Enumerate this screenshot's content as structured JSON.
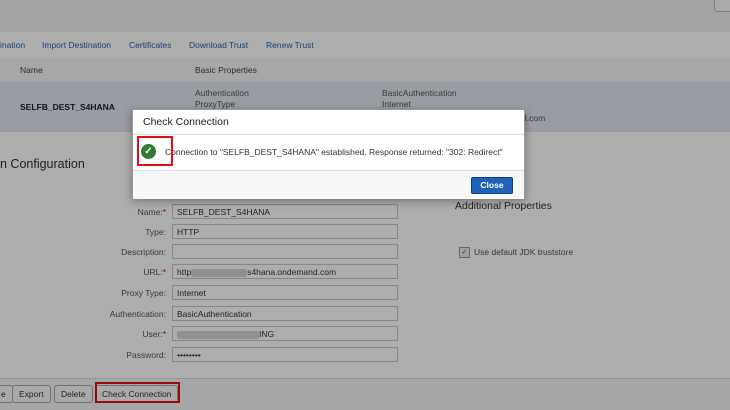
{
  "toolbar": {
    "items": [
      "ination",
      "Import Destination",
      "Certificates",
      "Download Trust",
      "Renew Trust"
    ]
  },
  "table": {
    "headers": [
      "Name",
      "Basic Properties"
    ],
    "row": {
      "name": "SELFB_DEST_S4HANA",
      "prop_label_1": "Authentication",
      "prop_label_2": "ProxyType",
      "prop_value_1": "BasicAuthentication",
      "prop_value_2": "Internet",
      "url_tail": "d.com"
    }
  },
  "section": {
    "title": "n Configuration",
    "additional_title": "Additional Properties"
  },
  "form": {
    "name_label": "Name:",
    "name_value": "SELFB_DEST_S4HANA",
    "type_label": "Type:",
    "type_value": "HTTP",
    "description_label": "Description:",
    "description_value": "",
    "url_label": "URL:",
    "url_prefix": "http",
    "url_suffix": "s4hana.ondemand.com",
    "proxy_label": "Proxy Type:",
    "proxy_value": "Internet",
    "auth_label": "Authentication:",
    "auth_value": "BasicAuthentication",
    "user_label": "User:",
    "user_suffix": "ING",
    "password_label": "Password:",
    "password_value": "••••••••",
    "required_mark": "*"
  },
  "jdk_checkbox": {
    "label": "Use default JDK truststore",
    "checked": true
  },
  "bottom_buttons": [
    "e",
    "Export",
    "Delete",
    "Check Connection"
  ],
  "dialog": {
    "title": "Check Connection",
    "message": "Connection to \"SELFB_DEST_S4HANA\" established. Response returned: \"302: Redirect\"",
    "close_label": "Close",
    "status_icon": "success-check-icon"
  },
  "colors": {
    "link": "#2b63a6",
    "accent": "#1e63b7",
    "success": "#2e7d32",
    "highlight": "#e01010"
  }
}
